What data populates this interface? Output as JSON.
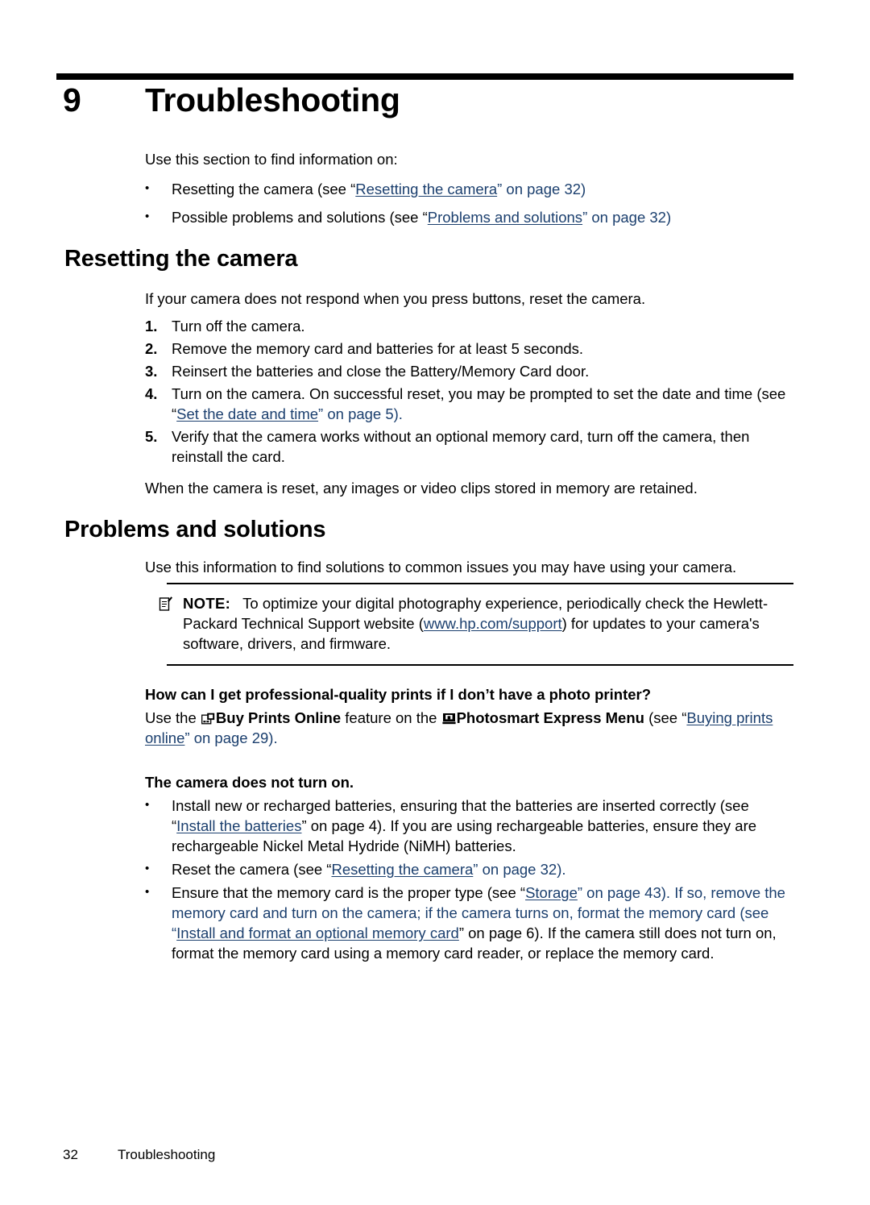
{
  "chapter": {
    "number": "9",
    "title": "Troubleshooting"
  },
  "intro": {
    "lead": "Use this section to find information on:",
    "bullets": [
      {
        "pre": "Resetting the camera (see “",
        "link": "Resetting the camera",
        "post": "” on page 32)"
      },
      {
        "pre": "Possible problems and solutions (see “",
        "link": "Problems and solutions",
        "post": "” on page 32)"
      }
    ]
  },
  "reset_section": {
    "heading": "Resetting the camera",
    "intro": "If your camera does not respond when you press buttons, reset the camera.",
    "steps": [
      {
        "num": "1.",
        "text": "Turn off the camera."
      },
      {
        "num": "2.",
        "text": "Remove the memory card and batteries for at least 5 seconds."
      },
      {
        "num": "3.",
        "text": "Reinsert the batteries and close the Battery/Memory Card door."
      },
      {
        "num": "4.",
        "pre": "Turn on the camera. On successful reset, you may be prompted to set the date and time (see “",
        "link": "Set the date and time",
        "post": "” on page 5)."
      },
      {
        "num": "5.",
        "text": "Verify that the camera works without an optional memory card, turn off the camera, then reinstall the card."
      }
    ],
    "closing": "When the camera is reset, any images or video clips stored in memory are retained."
  },
  "problems_section": {
    "heading": "Problems and solutions",
    "intro": "Use this information to find solutions to common issues you may have using your camera.",
    "note": {
      "icon": "note-pencil-icon",
      "label": "NOTE:",
      "text_before_link": "To optimize your digital photography experience, periodically check the Hewlett-Packard Technical Support website (",
      "link": "www.hp.com/support",
      "text_after_link": ") for updates to your camera's software, drivers, and firmware."
    },
    "faq": [
      {
        "question": "How can I get professional-quality prints if I don’t have a photo printer?",
        "answer_parts": {
          "t1": "Use the ",
          "icon1": "buy-prints-online-icon",
          "b1": "Buy Prints Online",
          "t2": " feature on the ",
          "icon2": "photosmart-express-icon",
          "b2": "Photosmart Express Menu",
          "t3": " (see “",
          "link": "Buying prints online",
          "t4": "” on page 29)."
        }
      },
      {
        "question": "The camera does not turn on.",
        "bullets": [
          {
            "pre": "Install new or recharged batteries, ensuring that the batteries are inserted correctly (see “",
            "link": "Install the batteries",
            "post": "” on page 4). If you are using rechargeable batteries, ensure they are rechargeable Nickel Metal Hydride (NiMH) batteries."
          },
          {
            "pre": "Reset the camera (see “",
            "link": "Resetting the camera",
            "post": "” on page 32)."
          },
          {
            "pre": "Ensure that the memory card is the proper type (see “",
            "link": "Storage",
            "mid": "” on page 43). If so, remove the memory card and turn on the camera; if the camera turns on, format the memory card (see “",
            "link2": "Install and format an optional memory card",
            "post": "” on page 6). If the camera still does not turn on, format the memory card using a memory card reader, or replace the memory card."
          }
        ]
      }
    ]
  },
  "footer": {
    "page_number": "32",
    "label": "Troubleshooting"
  },
  "colors": {
    "link": "#1b3f6e",
    "text": "#000000",
    "background": "#ffffff"
  }
}
